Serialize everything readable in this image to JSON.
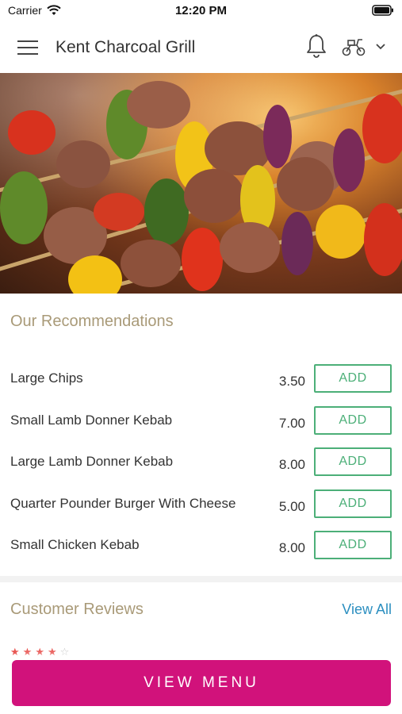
{
  "status_bar": {
    "carrier": "Carrier",
    "time": "12:20 PM"
  },
  "header": {
    "title": "Kent Charcoal Grill",
    "menu_icon": "menu-icon",
    "bell_icon": "bell-icon",
    "delivery_icon": "scooter-icon",
    "chevron_icon": "chevron-down-icon"
  },
  "recommendations": {
    "title": "Our Recommendations",
    "items": [
      {
        "name": "Large Chips",
        "price": "3.50",
        "button": "ADD"
      },
      {
        "name": "Small Lamb Donner Kebab",
        "price": "7.00",
        "button": "ADD"
      },
      {
        "name": "Large Lamb Donner Kebab",
        "price": "8.00",
        "button": "ADD"
      },
      {
        "name": "Quarter Pounder Burger With Cheese",
        "price": "5.00",
        "button": "ADD"
      },
      {
        "name": "Small Chicken Kebab",
        "price": "8.00",
        "button": "ADD"
      }
    ]
  },
  "reviews": {
    "title": "Customer Reviews",
    "view_all": "View All"
  },
  "footer": {
    "view_menu": "VIEW MENU"
  },
  "colors": {
    "accent": "#d1127b",
    "add_green": "#4caf78",
    "link_blue": "#2c8fc0",
    "section_gold": "#a99a78"
  }
}
